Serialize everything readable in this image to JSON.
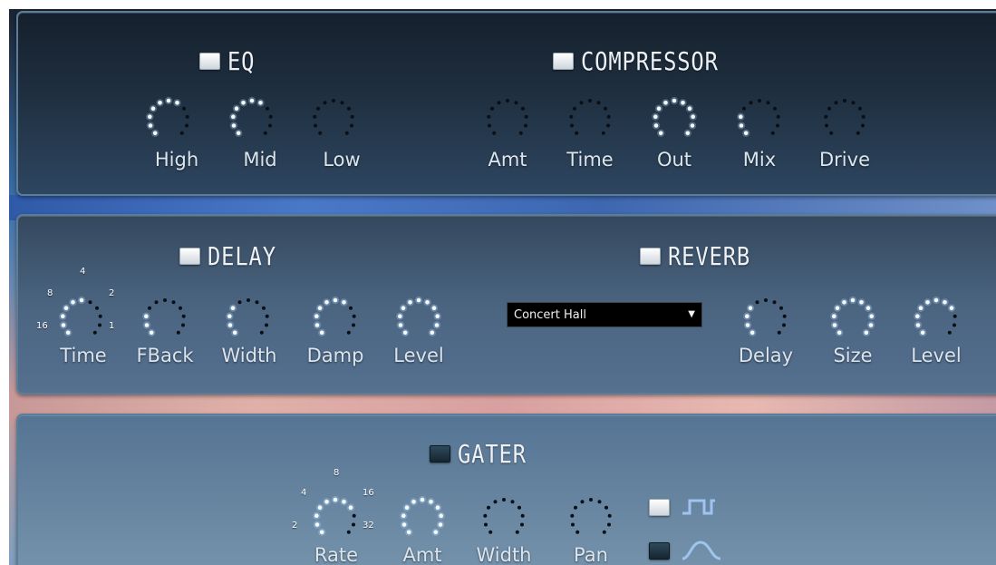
{
  "eq": {
    "title": "EQ",
    "enabled": true,
    "knobs": [
      {
        "label": "High",
        "level": 0.6
      },
      {
        "label": "Mid",
        "level": 0.65
      },
      {
        "label": "Low",
        "level": 0.0
      }
    ]
  },
  "compressor": {
    "title": "COMPRESSOR",
    "enabled": true,
    "knobs": [
      {
        "label": "Amt",
        "level": 0.0
      },
      {
        "label": "Time",
        "level": 0.0
      },
      {
        "label": "Out",
        "level": 1.0
      },
      {
        "label": "Mix",
        "level": 0.25
      },
      {
        "label": "Drive",
        "level": 0.0
      }
    ]
  },
  "delay": {
    "title": "DELAY",
    "enabled": true,
    "knobs": [
      {
        "label": "Time",
        "level": 0.55
      },
      {
        "label": "FBack",
        "level": 0.3
      },
      {
        "label": "Width",
        "level": 0.4
      },
      {
        "label": "Damp",
        "level": 0.65
      },
      {
        "label": "Level",
        "level": 1.0
      }
    ],
    "time_ticks": [
      "4",
      "8",
      "2",
      "16",
      "1"
    ]
  },
  "reverb": {
    "title": "REVERB",
    "enabled": true,
    "preset": "Concert Hall",
    "knobs": [
      {
        "label": "Delay",
        "level": 0.4
      },
      {
        "label": "Size",
        "level": 1.0
      },
      {
        "label": "Level",
        "level": 0.75
      }
    ]
  },
  "gater": {
    "title": "GATER",
    "enabled": false,
    "knobs": [
      {
        "label": "Rate",
        "level": 0.7
      },
      {
        "label": "Amt",
        "level": 1.0
      },
      {
        "label": "Width",
        "level": 0.0
      },
      {
        "label": "Pan",
        "level": 0.0
      }
    ],
    "rate_ticks": [
      "8",
      "4",
      "16",
      "2",
      "32"
    ],
    "waveforms": [
      {
        "icon": "square-wave-icon",
        "selected": true
      },
      {
        "icon": "sine-wave-icon",
        "selected": false
      }
    ]
  },
  "colors": {
    "led_on": "#f4fbff",
    "led_off": "#0b0f14",
    "accent_blue": "#9fc4ee",
    "text": "#dbe5ee"
  }
}
